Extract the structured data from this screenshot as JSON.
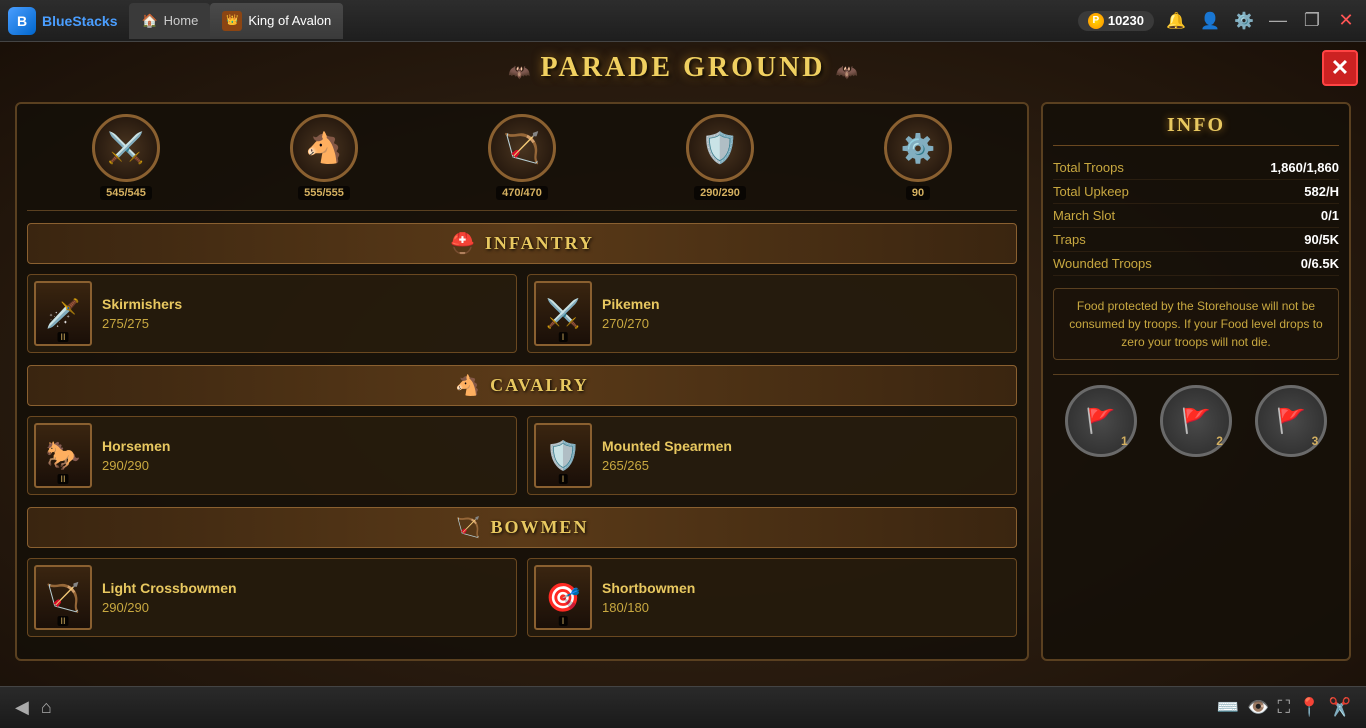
{
  "app": {
    "name": "BlueStacks",
    "tab_home": "Home",
    "tab_game": "King of Avalon",
    "coins": "10230"
  },
  "window": {
    "minimize": "—",
    "maximize": "❐",
    "close": "✕"
  },
  "title": "PARADE GROUND",
  "close_btn": "✕",
  "unit_icons": [
    {
      "emoji": "⚔️",
      "count": "545/545"
    },
    {
      "emoji": "🐴",
      "count": "555/555"
    },
    {
      "emoji": "🏹",
      "count": "470/470"
    },
    {
      "emoji": "🛡️",
      "count": "290/290"
    },
    {
      "emoji": "⚙️",
      "count": "90"
    }
  ],
  "sections": {
    "infantry": {
      "title": "INFANTRY",
      "icon": "⛑️",
      "troops": [
        {
          "name": "Skirmishers",
          "count": "275/275",
          "emoji": "🗡️",
          "tier": "II"
        },
        {
          "name": "Pikemen",
          "count": "270/270",
          "emoji": "⚔️",
          "tier": "I"
        }
      ]
    },
    "cavalry": {
      "title": "CAVALRY",
      "icon": "🐴",
      "troops": [
        {
          "name": "Horsemen",
          "count": "290/290",
          "emoji": "🐎",
          "tier": "II"
        },
        {
          "name": "Mounted Spearmen",
          "count": "265/265",
          "emoji": "🛡️",
          "tier": "I"
        }
      ]
    },
    "bowmen": {
      "title": "BOWMEN",
      "icon": "🏹",
      "troops": [
        {
          "name": "Light Crossbowmen",
          "count": "290/290",
          "emoji": "🏹",
          "tier": "II"
        },
        {
          "name": "Shortbowmen",
          "count": "180/180",
          "emoji": "🎯",
          "tier": "I"
        }
      ]
    }
  },
  "info": {
    "title": "INFO",
    "rows": [
      {
        "label": "Total Troops",
        "value": "1,860/1,860"
      },
      {
        "label": "Total Upkeep",
        "value": "582/H"
      },
      {
        "label": "March Slot",
        "value": "0/1"
      },
      {
        "label": "Traps",
        "value": "90/5K"
      },
      {
        "label": "Wounded Troops",
        "value": "0/6.5K"
      }
    ],
    "food_notice": "Food protected by the Storehouse will not be consumed by troops. If your Food level drops to zero your troops will not die.",
    "flags": [
      {
        "label": "1",
        "emoji": "🚩"
      },
      {
        "label": "2",
        "emoji": "🚩"
      },
      {
        "label": "3",
        "emoji": "🚩"
      }
    ]
  }
}
